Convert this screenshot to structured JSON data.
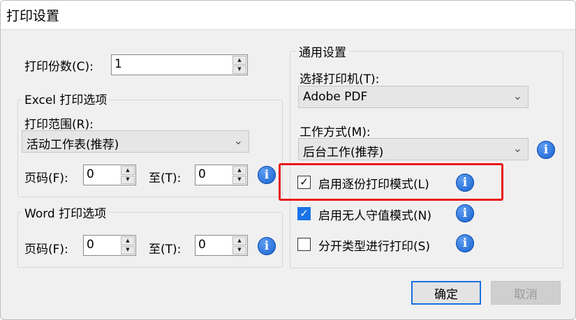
{
  "window": {
    "title": "打印设置"
  },
  "copies": {
    "label": "打印份数(C):",
    "value": "1"
  },
  "excel_group": {
    "title": "Excel 打印选项",
    "range_label": "打印范围(R):",
    "range_value": "活动工作表(推荐)",
    "pages_label": "页码(F):",
    "from_value": "0",
    "to_label": "至(T):",
    "to_value": "0"
  },
  "word_group": {
    "title": "Word 打印选项",
    "pages_label": "页码(F):",
    "from_value": "0",
    "to_label": "至(T):",
    "to_value": "0"
  },
  "general_group": {
    "title": "通用设置",
    "printer_label": "选择打印机(T):",
    "printer_value": "Adobe PDF",
    "mode_label": "工作方式(M):",
    "mode_value": "后台工作(推荐)"
  },
  "options": [
    {
      "label": "启用逐份打印模式(L)",
      "checked": true
    },
    {
      "label": "启用无人守值模式(N)",
      "checked": true
    },
    {
      "label": "分开类型进行打印(S)",
      "checked": false
    }
  ],
  "buttons": {
    "ok": "确定",
    "cancel": "取消"
  },
  "icons": {
    "info": "info-icon",
    "check": "✓",
    "up": "▲",
    "down": "▼",
    "chevron": "⌄"
  },
  "colors": {
    "highlight": "#e8171b",
    "info": "#1560cf",
    "primary_border": "#1a6fe0",
    "checkbox_blue": "#1a73e8"
  }
}
